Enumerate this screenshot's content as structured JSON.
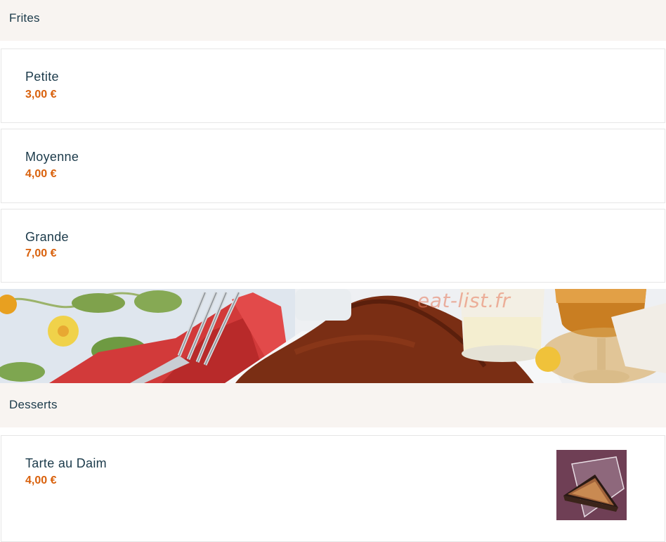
{
  "sections": [
    {
      "title": "Frites",
      "items": [
        {
          "name": "Petite",
          "price": "3,00 €"
        },
        {
          "name": "Moyenne",
          "price": "4,00 €"
        },
        {
          "name": "Grande",
          "price": "7,00 €"
        }
      ]
    },
    {
      "title": "Desserts",
      "items": [
        {
          "name": "Tarte au Daim",
          "price": "4,00 €"
        }
      ]
    }
  ],
  "banner": {
    "watermark": "eat-list.fr"
  },
  "colors": {
    "header_bg": "#f8f4f1",
    "text": "#1b3a4a",
    "price": "#d9610c",
    "card_border": "#e6e6e6"
  }
}
